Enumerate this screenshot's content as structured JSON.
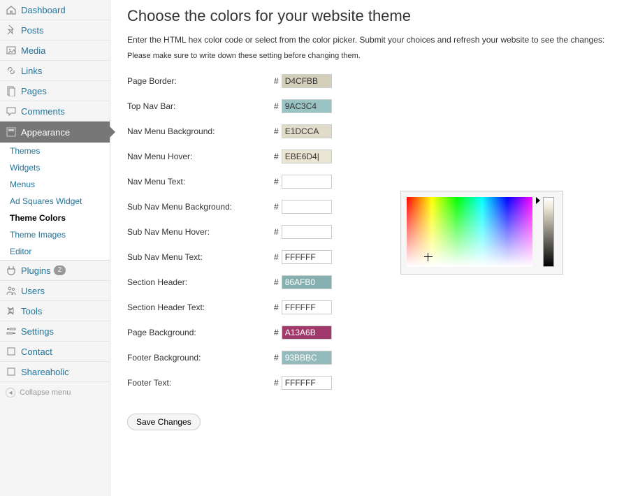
{
  "sidebar": {
    "items": [
      {
        "label": "Dashboard",
        "icon": "home"
      },
      {
        "label": "Posts",
        "icon": "pin"
      },
      {
        "label": "Media",
        "icon": "media"
      },
      {
        "label": "Links",
        "icon": "link"
      },
      {
        "label": "Pages",
        "icon": "page"
      },
      {
        "label": "Comments",
        "icon": "comment"
      },
      {
        "label": "Appearance",
        "icon": "appearance",
        "active": true
      },
      {
        "label": "Plugins",
        "icon": "plugin",
        "badge": "2"
      },
      {
        "label": "Users",
        "icon": "users"
      },
      {
        "label": "Tools",
        "icon": "tools"
      },
      {
        "label": "Settings",
        "icon": "settings"
      },
      {
        "label": "Contact",
        "icon": "generic"
      },
      {
        "label": "Shareaholic",
        "icon": "generic"
      }
    ],
    "submenu": [
      {
        "label": "Themes"
      },
      {
        "label": "Widgets"
      },
      {
        "label": "Menus"
      },
      {
        "label": "Ad Squares Widget"
      },
      {
        "label": "Theme Colors",
        "active": true
      },
      {
        "label": "Theme Images"
      },
      {
        "label": "Editor"
      }
    ],
    "collapse": "Collapse menu"
  },
  "page": {
    "title": "Choose the colors for your website theme",
    "instruction": "Enter the HTML hex color code or select from the color picker. Submit your choices and refresh your website to see the changes:",
    "note": "Please make sure to write down these setting before changing them.",
    "save": "Save Changes"
  },
  "fields": [
    {
      "label": "Page Border:",
      "value": "D4CFBB",
      "bg": "#D4CFBB",
      "dark": true
    },
    {
      "label": "Top Nav Bar:",
      "value": "9AC3C4",
      "bg": "#9AC3C4",
      "dark": true
    },
    {
      "label": "Nav Menu Background:",
      "value": "E1DCCA",
      "bg": "#E1DCCA",
      "dark": true
    },
    {
      "label": "Nav Menu Hover:",
      "value": "EBE6D4|",
      "bg": "#EBE6D4",
      "dark": true
    },
    {
      "label": "Nav Menu Text:",
      "value": "",
      "bg": "#fff",
      "dark": true
    },
    {
      "label": "Sub Nav Menu Background:",
      "value": "",
      "bg": "#fff",
      "dark": true
    },
    {
      "label": "Sub Nav Menu Hover:",
      "value": "",
      "bg": "#fff",
      "dark": true
    },
    {
      "label": "Sub Nav Menu Text:",
      "value": "FFFFFF",
      "bg": "#fff",
      "dark": true
    },
    {
      "label": "Section Header:",
      "value": "86AFB0",
      "bg": "#86AFB0",
      "dark": false
    },
    {
      "label": "Section Header Text:",
      "value": "FFFFFF",
      "bg": "#fff",
      "dark": true
    },
    {
      "label": "Page Background:",
      "value": "A13A6B",
      "bg": "#A13A6B",
      "dark": false
    },
    {
      "label": "Footer Background:",
      "value": "93BBBC",
      "bg": "#93BBBC",
      "dark": false
    },
    {
      "label": "Footer Text:",
      "value": "FFFFFF",
      "bg": "#fff",
      "dark": true
    }
  ]
}
